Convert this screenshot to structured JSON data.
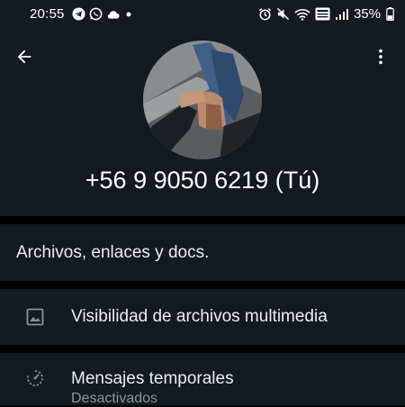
{
  "status_bar": {
    "time": "20:55",
    "battery": "35%",
    "left_icons": [
      "telegram-icon",
      "whatsapp-icon",
      "cloud-icon",
      "dot-icon"
    ],
    "right_icons": [
      "alarm-icon",
      "mute-icon",
      "wifi-icon",
      "volte-icon",
      "signal-icon",
      "battery-icon"
    ]
  },
  "header": {
    "back_icon": "arrow-left-icon",
    "menu_icon": "more-vertical-icon"
  },
  "profile": {
    "phone": "+56 9 9050 6219 (Tú)"
  },
  "sections": {
    "files_label": "Archivos, enlaces y docs.",
    "media_visibility_label": "Visibilidad de archivos multimedia",
    "temp_messages_label": "Mensajes temporales",
    "temp_messages_value": "Desactivados"
  },
  "colors": {
    "background": "#000000",
    "surface": "#111b21",
    "text_primary": "#e9edef",
    "text_secondary": "#8696a0"
  }
}
